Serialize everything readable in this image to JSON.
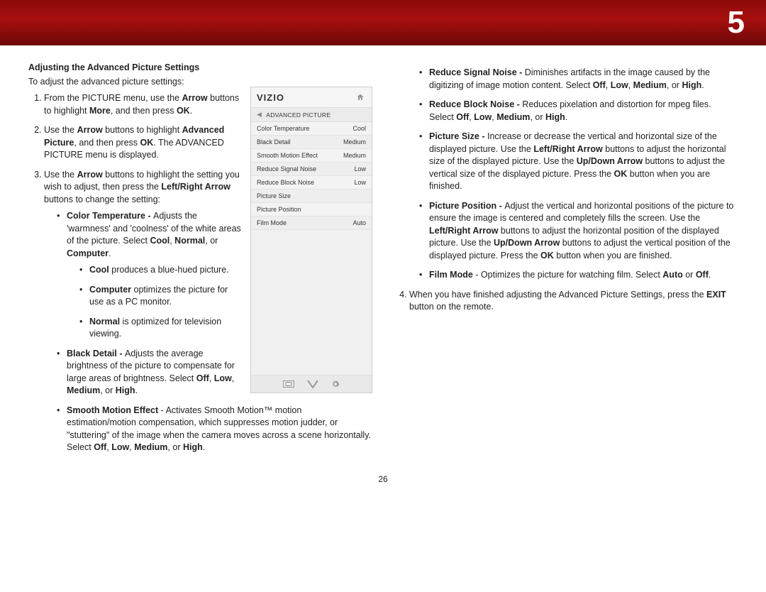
{
  "chapter_number": "5",
  "page_number_bottom": "26",
  "section_title": "Adjusting the Advanced Picture Settings",
  "intro": "To adjust the advanced picture settings:",
  "osd": {
    "logo": "VIZIO",
    "submenu_title": "ADVANCED PICTURE",
    "rows": [
      {
        "label": "Color Temperature",
        "value": "Cool"
      },
      {
        "label": "Black Detail",
        "value": "Medium"
      },
      {
        "label": "Smooth Motion Effect",
        "value": "Medium"
      },
      {
        "label": "Reduce Signal Noise",
        "value": "Low"
      },
      {
        "label": "Reduce Block Noise",
        "value": "Low"
      },
      {
        "label": "Picture Size",
        "value": ""
      },
      {
        "label": "Picture Position",
        "value": ""
      },
      {
        "label": "Film Mode",
        "value": "Auto"
      }
    ]
  },
  "left_steps": {
    "s1_a": "From the PICTURE menu, use the ",
    "s1_b": "Arrow",
    "s1_c": " buttons to highlight ",
    "s1_d": "More",
    "s1_e": ", and then press ",
    "s1_f": "OK",
    "s1_g": ".",
    "s2_a": "Use the ",
    "s2_b": "Arrow",
    "s2_c": " buttons to highlight ",
    "s2_d": "Advanced Picture",
    "s2_e": ", and then press ",
    "s2_f": "OK",
    "s2_g": ". The ADVANCED PICTURE menu is displayed.",
    "s3_a": "Use the ",
    "s3_b": "Arrow",
    "s3_c": " buttons to highlight the setting you wish to adjust, then press the ",
    "s3_d": "Left/Right Arrow",
    "s3_e": " buttons to change the setting:"
  },
  "left_bullets": {
    "ct_t": "Color Temperature - ",
    "ct_a": "Adjusts the 'warmness' and 'coolness' of the white areas of the picture. Select ",
    "ct_b": "Cool",
    "ct_c": ", ",
    "ct_d": "Normal",
    "ct_e": ", or ",
    "ct_f": "Computer",
    "ct_g": ".",
    "ct_cool_t": "Cool",
    "ct_cool_a": " produces a blue-hued picture.",
    "ct_comp_t": "Computer",
    "ct_comp_a": " optimizes the picture for use as a PC monitor.",
    "ct_norm_t": "Normal",
    "ct_norm_a": " is optimized for television viewing.",
    "bd_t": "Black Detail - ",
    "bd_a": "Adjusts the average brightness of the picture to compensate for large areas of brightness. Select ",
    "bd_b": "Off",
    "bd_c": ", ",
    "bd_d": "Low",
    "bd_e": ", ",
    "bd_f": "Medium",
    "bd_g": ", or ",
    "bd_h": "High",
    "bd_i": ".",
    "sm_t": "Smooth Motion Effect",
    "sm_a": " - Activates Smooth Motion™ motion estimation/motion compensation, which suppresses motion judder, or \"stuttering\" of the image when the camera moves across a scene horizontally. Select ",
    "sm_b": "Off",
    "sm_c": ", ",
    "sm_d": "Low",
    "sm_e": ", ",
    "sm_f": "Medium",
    "sm_g": ", or ",
    "sm_h": "High",
    "sm_i": "."
  },
  "right_bullets": {
    "rsn_t": "Reduce Signal Noise - ",
    "rsn_a": "Diminishes artifacts in the image caused by the digitizing of image motion content. Select ",
    "rsn_b": "Off",
    "rsn_c": ", ",
    "rsn_d": "Low",
    "rsn_e": ", ",
    "rsn_f": "Medium",
    "rsn_g": ", or ",
    "rsn_h": "High",
    "rsn_i": ".",
    "rbn_t": "Reduce Block Noise - ",
    "rbn_a": "Reduces pixelation and distortion for mpeg files. Select ",
    "rbn_b": "Off",
    "rbn_c": ", ",
    "rbn_d": "Low",
    "rbn_e": ", ",
    "rbn_f": "Medium",
    "rbn_g": ", or ",
    "rbn_h": "High",
    "rbn_i": ".",
    "ps_t": "Picture Size - ",
    "ps_a": "Increase or decrease the vertical and horizontal size of the displayed picture. Use the ",
    "ps_b": "Left/Right Arrow",
    "ps_c": " buttons to adjust the horizontal size of the displayed picture. Use the ",
    "ps_d": "Up/Down Arrow",
    "ps_e": " buttons to adjust the vertical size of the displayed picture. Press the ",
    "ps_f": "OK",
    "ps_g": " button when you are finished.",
    "pp_t": "Picture Position - ",
    "pp_a": "Adjust the vertical and horizontal positions of the picture to ensure the image is centered and completely fills the screen. Use the ",
    "pp_b": "Left/Right Arrow",
    "pp_c": " buttons to adjust the horizontal position of the displayed picture. Use the ",
    "pp_d": "Up/Down Arrow",
    "pp_e": " buttons to adjust the vertical position of the displayed picture. Press the ",
    "pp_f": "OK",
    "pp_g": " button when you are finished.",
    "fm_t": "Film Mode",
    "fm_a": " - Optimizes the picture for watching film. Select ",
    "fm_b": "Auto",
    "fm_c": " or ",
    "fm_d": "Off",
    "fm_e": "."
  },
  "right_step4_a": "When you have finished adjusting the Advanced Picture Settings, press the ",
  "right_step4_b": "EXIT",
  "right_step4_c": " button on the remote."
}
